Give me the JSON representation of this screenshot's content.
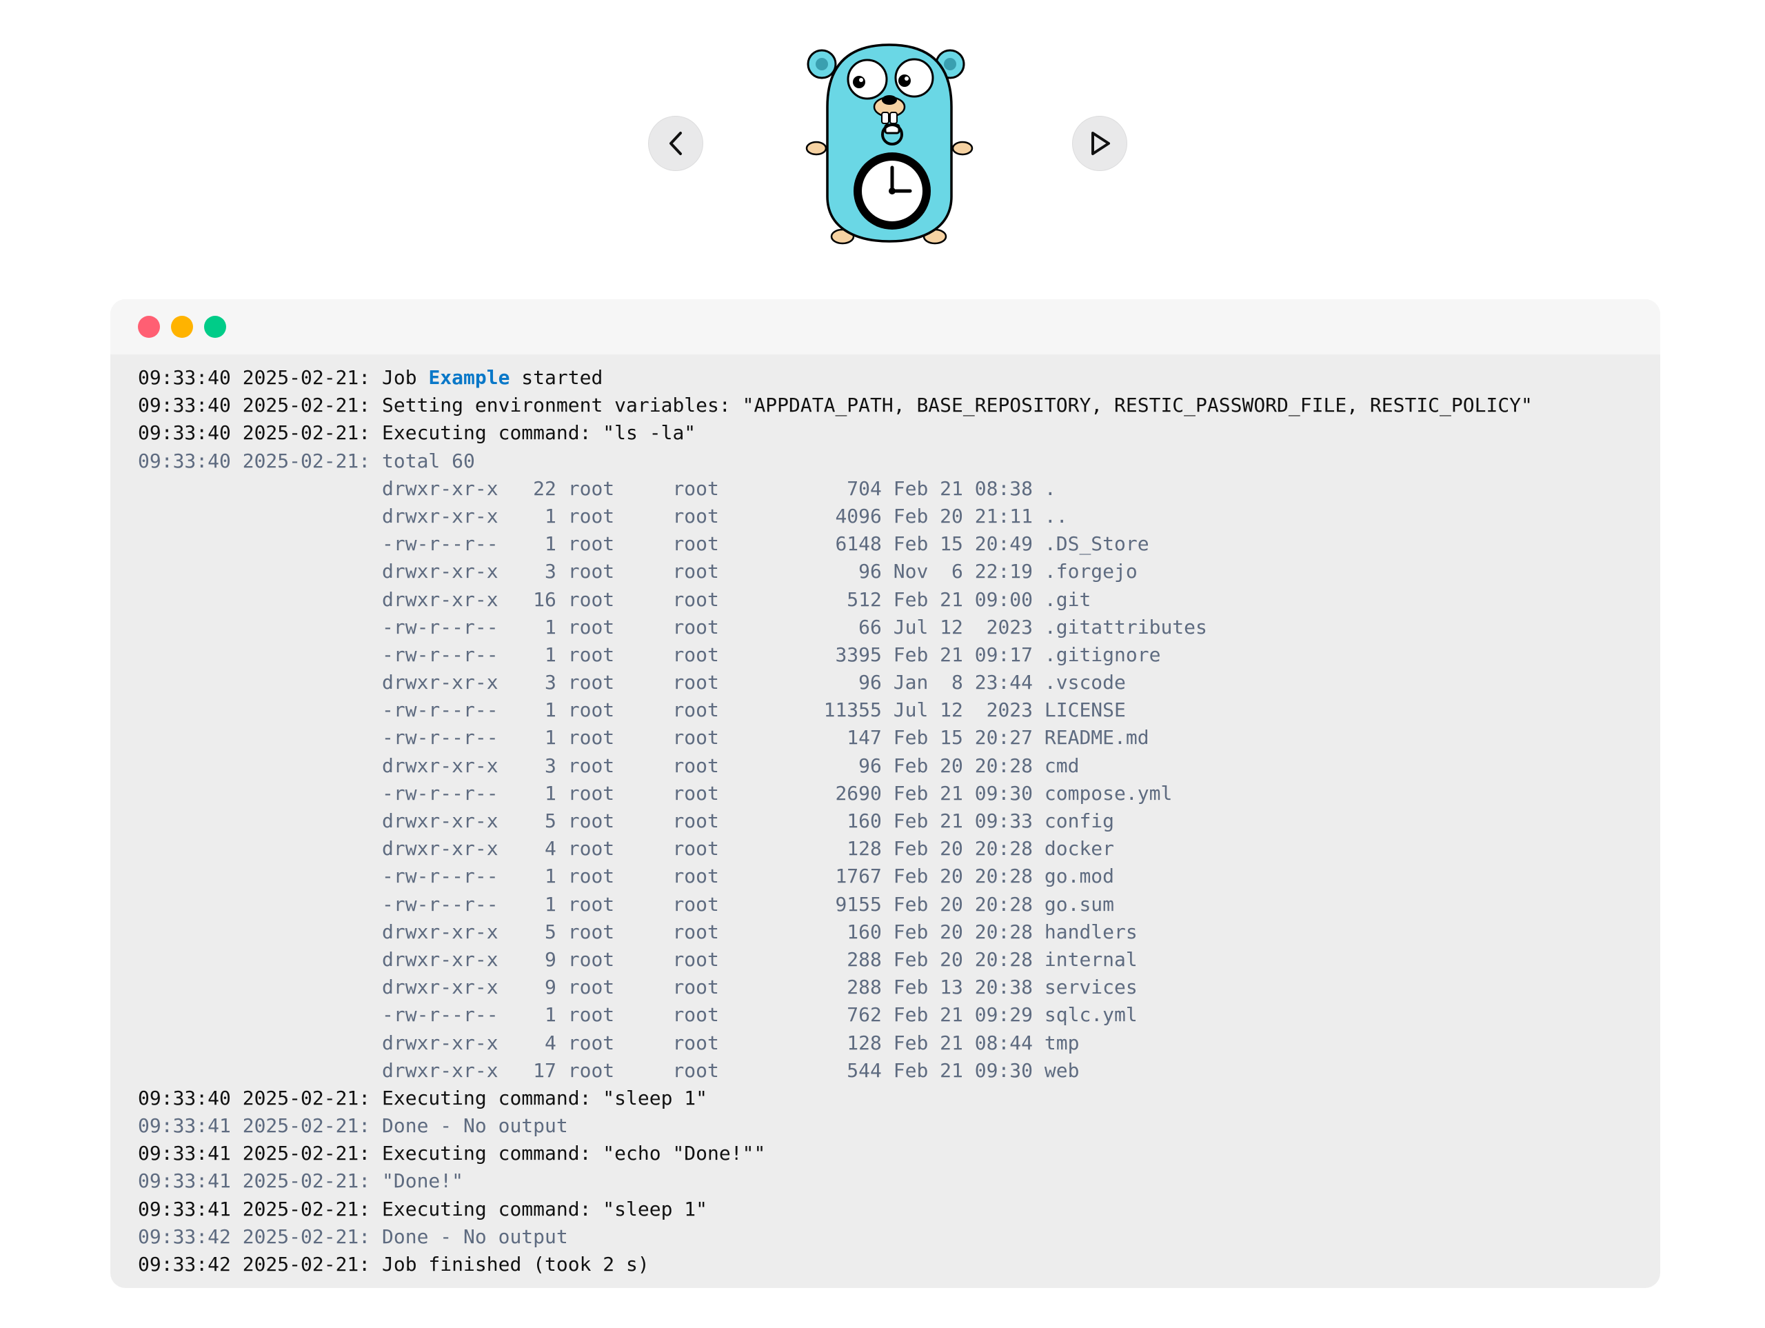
{
  "nav": {
    "prev_icon": "chevron-left-icon",
    "next_icon": "play-icon"
  },
  "mascot": {
    "icon": "gopher-stopwatch-logo"
  },
  "terminal": {
    "window_controls": [
      "close",
      "minimize",
      "maximize"
    ],
    "colors": {
      "close": "#ff5f73",
      "minimize": "#ffb300",
      "maximize": "#00cc88",
      "accent": "#0a78c8",
      "primary_text": "#111111",
      "secondary_text": "#5e6b80"
    },
    "lines": [
      {
        "style": "main",
        "text": "09:33:40 2025-02-21: Job ",
        "highlight": "Example",
        "after": " started"
      },
      {
        "style": "main",
        "text": "09:33:40 2025-02-21: Setting environment variables: \"APPDATA_PATH, BASE_REPOSITORY, RESTIC_PASSWORD_FILE, RESTIC_POLICY\""
      },
      {
        "style": "main",
        "text": "09:33:40 2025-02-21: Executing command: \"ls -la\""
      },
      {
        "style": "sub",
        "text": "09:33:40 2025-02-21: total 60"
      },
      {
        "style": "sub",
        "text": "                     drwxr-xr-x   22 root     root           704 Feb 21 08:38 ."
      },
      {
        "style": "sub",
        "text": "                     drwxr-xr-x    1 root     root          4096 Feb 20 21:11 .."
      },
      {
        "style": "sub",
        "text": "                     -rw-r--r--    1 root     root          6148 Feb 15 20:49 .DS_Store"
      },
      {
        "style": "sub",
        "text": "                     drwxr-xr-x    3 root     root            96 Nov  6 22:19 .forgejo"
      },
      {
        "style": "sub",
        "text": "                     drwxr-xr-x   16 root     root           512 Feb 21 09:00 .git"
      },
      {
        "style": "sub",
        "text": "                     -rw-r--r--    1 root     root            66 Jul 12  2023 .gitattributes"
      },
      {
        "style": "sub",
        "text": "                     -rw-r--r--    1 root     root          3395 Feb 21 09:17 .gitignore"
      },
      {
        "style": "sub",
        "text": "                     drwxr-xr-x    3 root     root            96 Jan  8 23:44 .vscode"
      },
      {
        "style": "sub",
        "text": "                     -rw-r--r--    1 root     root         11355 Jul 12  2023 LICENSE"
      },
      {
        "style": "sub",
        "text": "                     -rw-r--r--    1 root     root           147 Feb 15 20:27 README.md"
      },
      {
        "style": "sub",
        "text": "                     drwxr-xr-x    3 root     root            96 Feb 20 20:28 cmd"
      },
      {
        "style": "sub",
        "text": "                     -rw-r--r--    1 root     root          2690 Feb 21 09:30 compose.yml"
      },
      {
        "style": "sub",
        "text": "                     drwxr-xr-x    5 root     root           160 Feb 21 09:33 config"
      },
      {
        "style": "sub",
        "text": "                     drwxr-xr-x    4 root     root           128 Feb 20 20:28 docker"
      },
      {
        "style": "sub",
        "text": "                     -rw-r--r--    1 root     root          1767 Feb 20 20:28 go.mod"
      },
      {
        "style": "sub",
        "text": "                     -rw-r--r--    1 root     root          9155 Feb 20 20:28 go.sum"
      },
      {
        "style": "sub",
        "text": "                     drwxr-xr-x    5 root     root           160 Feb 20 20:28 handlers"
      },
      {
        "style": "sub",
        "text": "                     drwxr-xr-x    9 root     root           288 Feb 20 20:28 internal"
      },
      {
        "style": "sub",
        "text": "                     drwxr-xr-x    9 root     root           288 Feb 13 20:38 services"
      },
      {
        "style": "sub",
        "text": "                     -rw-r--r--    1 root     root           762 Feb 21 09:29 sqlc.yml"
      },
      {
        "style": "sub",
        "text": "                     drwxr-xr-x    4 root     root           128 Feb 21 08:44 tmp"
      },
      {
        "style": "sub",
        "text": "                     drwxr-xr-x   17 root     root           544 Feb 21 09:30 web"
      },
      {
        "style": "main",
        "text": "09:33:40 2025-02-21: Executing command: \"sleep 1\""
      },
      {
        "style": "sub",
        "text": "09:33:41 2025-02-21: Done - No output"
      },
      {
        "style": "main",
        "text": "09:33:41 2025-02-21: Executing command: \"echo \"Done!\"\""
      },
      {
        "style": "sub",
        "text": "09:33:41 2025-02-21: \"Done!\""
      },
      {
        "style": "main",
        "text": "09:33:41 2025-02-21: Executing command: \"sleep 1\""
      },
      {
        "style": "sub",
        "text": "09:33:42 2025-02-21: Done - No output"
      },
      {
        "style": "main",
        "text": "09:33:42 2025-02-21: Job finished (took 2 s)"
      }
    ]
  }
}
